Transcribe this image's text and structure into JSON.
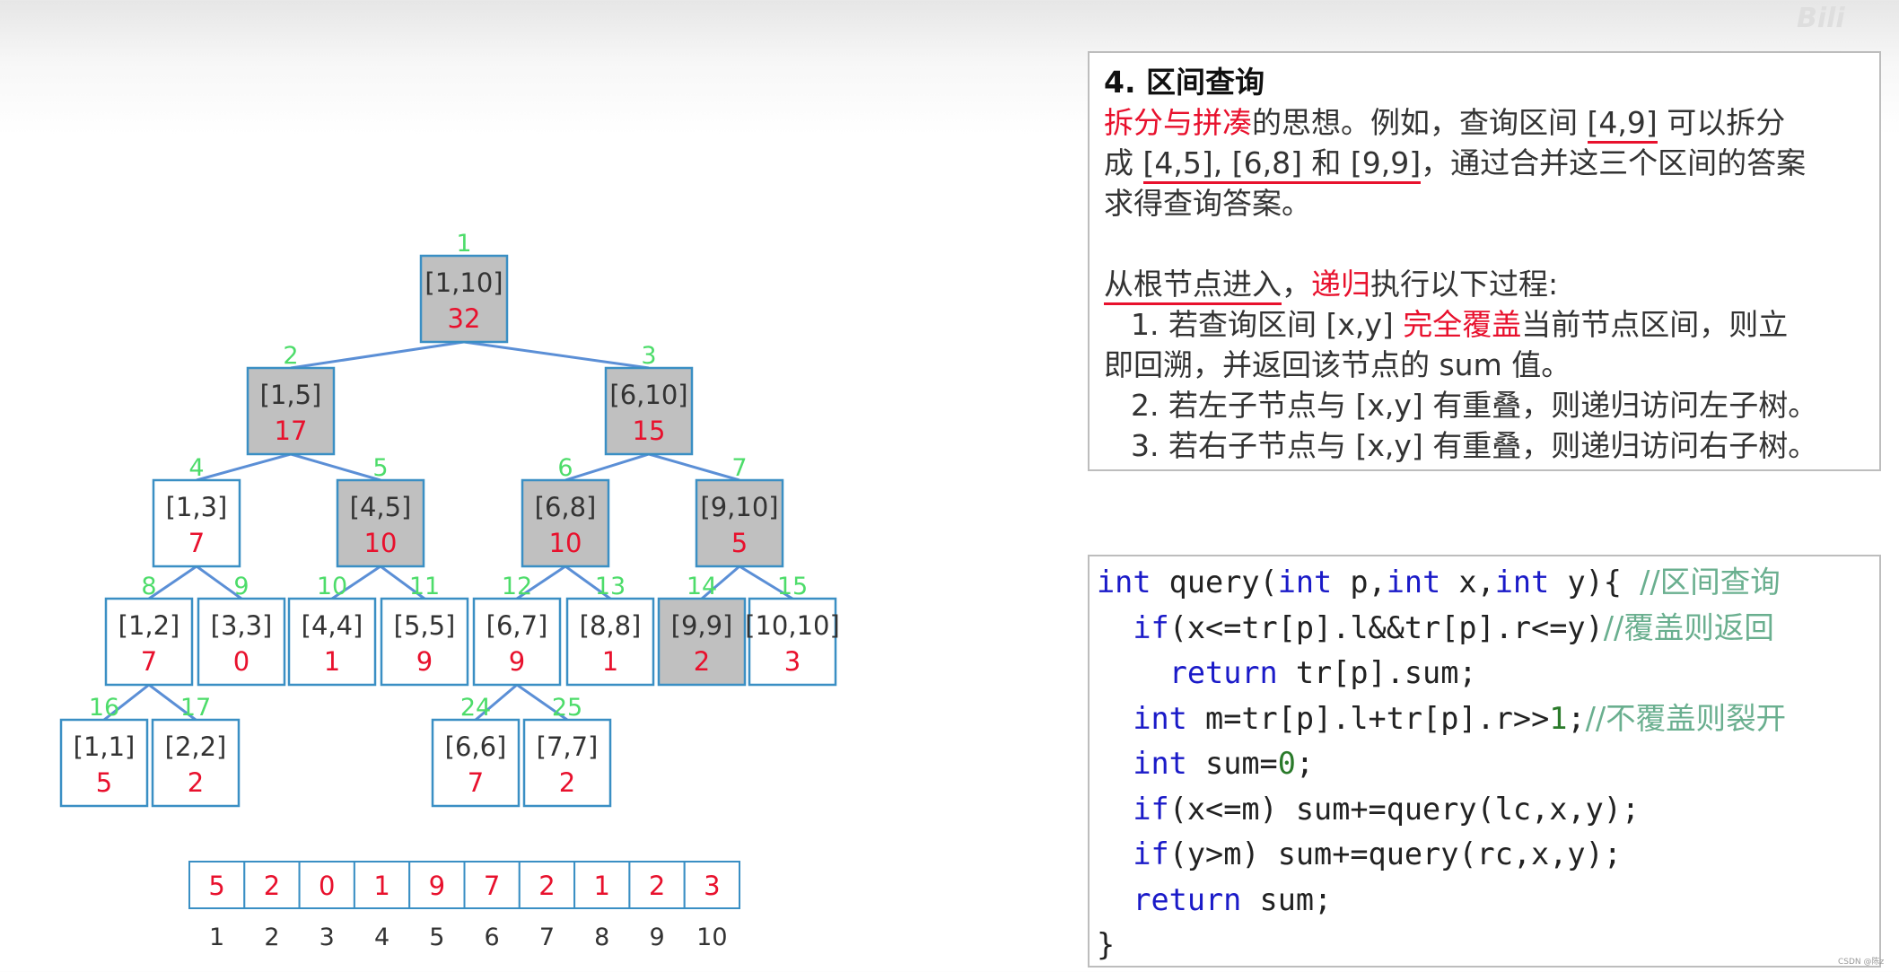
{
  "watermark": "bilibili",
  "tree": {
    "nodes": [
      {
        "id": 1,
        "range": "[1,10]",
        "sum": "32",
        "shaded": true
      },
      {
        "id": 2,
        "range": "[1,5]",
        "sum": "17",
        "shaded": true
      },
      {
        "id": 3,
        "range": "[6,10]",
        "sum": "15",
        "shaded": true
      },
      {
        "id": 4,
        "range": "[1,3]",
        "sum": "7",
        "shaded": false
      },
      {
        "id": 5,
        "range": "[4,5]",
        "sum": "10",
        "shaded": true
      },
      {
        "id": 6,
        "range": "[6,8]",
        "sum": "10",
        "shaded": true
      },
      {
        "id": 7,
        "range": "[9,10]",
        "sum": "5",
        "shaded": true
      },
      {
        "id": 8,
        "range": "[1,2]",
        "sum": "7",
        "shaded": false
      },
      {
        "id": 9,
        "range": "[3,3]",
        "sum": "0",
        "shaded": false
      },
      {
        "id": 10,
        "range": "[4,4]",
        "sum": "1",
        "shaded": false
      },
      {
        "id": 11,
        "range": "[5,5]",
        "sum": "9",
        "shaded": false
      },
      {
        "id": 12,
        "range": "[6,7]",
        "sum": "9",
        "shaded": false
      },
      {
        "id": 13,
        "range": "[8,8]",
        "sum": "1",
        "shaded": false
      },
      {
        "id": 14,
        "range": "[9,9]",
        "sum": "2",
        "shaded": true
      },
      {
        "id": 15,
        "range": "[10,10]",
        "sum": "3",
        "shaded": false
      },
      {
        "id": 16,
        "range": "[1,1]",
        "sum": "5",
        "shaded": false
      },
      {
        "id": 17,
        "range": "[2,2]",
        "sum": "2",
        "shaded": false
      },
      {
        "id": 24,
        "range": "[6,6]",
        "sum": "7",
        "shaded": false
      },
      {
        "id": 25,
        "range": "[7,7]",
        "sum": "2",
        "shaded": false
      }
    ],
    "edges": [
      [
        1,
        2
      ],
      [
        1,
        3
      ],
      [
        2,
        4
      ],
      [
        2,
        5
      ],
      [
        3,
        6
      ],
      [
        3,
        7
      ],
      [
        4,
        8
      ],
      [
        4,
        9
      ],
      [
        5,
        10
      ],
      [
        5,
        11
      ],
      [
        6,
        12
      ],
      [
        6,
        13
      ],
      [
        7,
        14
      ],
      [
        7,
        15
      ],
      [
        8,
        16
      ],
      [
        8,
        17
      ],
      [
        12,
        24
      ],
      [
        12,
        25
      ]
    ],
    "colors": {
      "box_stroke": "#3a8fc4",
      "edge": "#5b8fd6",
      "shaded_fill": "#c0c0c0",
      "id_label": "#4ddc6a",
      "range_text": "#333333",
      "sum_text": "#e8112d"
    }
  },
  "array": {
    "values": [
      "5",
      "2",
      "0",
      "1",
      "9",
      "7",
      "2",
      "1",
      "2",
      "3"
    ],
    "indices": [
      "1",
      "2",
      "3",
      "4",
      "5",
      "6",
      "7",
      "8",
      "9",
      "10"
    ]
  },
  "panel": {
    "heading": "4.  区间查询",
    "l1_red": "拆分与拼凑",
    "l1_rest": "的思想。例如，查询区间 ",
    "l1_ul": "[4,9]",
    "l1_end": " 可以拆分",
    "l2_pre": "成 ",
    "l2_ul": "[4,5], [6,8] 和 [9,9]",
    "l2_end": "，通过合并这三个区间的答案",
    "l3": "求得查询答案。",
    "l4_ul": "从根节点进入",
    "l4_comma": "，",
    "l4_red": "递归",
    "l4_end": "执行以下过程:",
    "s1_pre": "1. 若查询区间 [x,y] ",
    "s1_red": "完全覆盖",
    "s1_end": "当前节点区间，则立",
    "s1_cont": "即回溯，并返回该节点的 sum 值。",
    "s2": "2. 若左子节点与 [x,y] 有重叠，则递归访问左子树。",
    "s3": "3. 若右子节点与 [x,y] 有重叠，则递归访问右子树。"
  },
  "code": {
    "c1_kw1": "int",
    "c1_a": " query(",
    "c1_kw2": "int",
    "c1_b": " p,",
    "c1_kw3": "int",
    "c1_c": " x,",
    "c1_kw4": "int",
    "c1_d": " y){ ",
    "c1_cm": "//区间查询",
    "c2_kw": "if",
    "c2_a": "(x<=tr[p].l&&tr[p].r<=y)",
    "c2_cm": "//覆盖则返回",
    "c3_kw": "return",
    "c3_a": " tr[p].sum;",
    "c4_kw": "int",
    "c4_a": " m=tr[p].l+tr[p].r>>",
    "c4_num": "1",
    "c4_b": ";",
    "c4_cm": "//不覆盖则裂开",
    "c5_kw": "int",
    "c5_a": " sum=",
    "c5_num": "0",
    "c5_b": ";",
    "c6_kw": "if",
    "c6_a": "(x<=m) sum+=query(lc,x,y);",
    "c7_kw": "if",
    "c7_a": "(y>m) sum+=query(rc,x,y);",
    "c8_kw": "return",
    "c8_a": " sum;",
    "c9": "}"
  },
  "footer": "CSDN @陈z"
}
